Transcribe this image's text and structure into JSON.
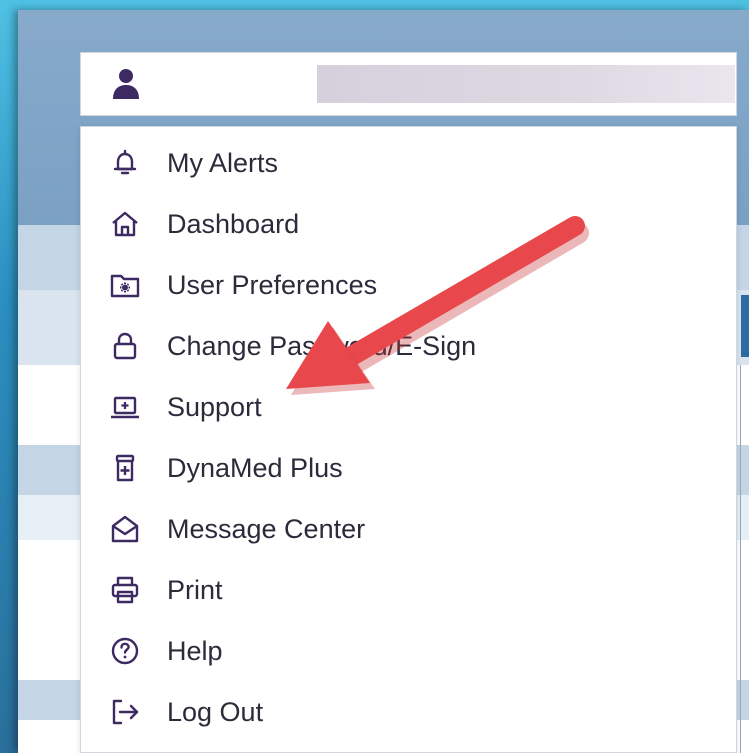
{
  "user_bar": {
    "user_icon": "user-icon",
    "username_redacted": true
  },
  "menu": {
    "items": [
      {
        "label": "My Alerts",
        "icon": "bell-icon"
      },
      {
        "label": "Dashboard",
        "icon": "home-icon"
      },
      {
        "label": "User Preferences",
        "icon": "folder-gear-icon"
      },
      {
        "label": "Change Password/E-Sign",
        "icon": "lock-icon"
      },
      {
        "label": "Support",
        "icon": "laptop-icon"
      },
      {
        "label": "DynaMed Plus",
        "icon": "medical-jar-icon"
      },
      {
        "label": "Message Center",
        "icon": "envelope-open-icon"
      },
      {
        "label": "Print",
        "icon": "printer-icon"
      },
      {
        "label": "Help",
        "icon": "help-circle-icon"
      },
      {
        "label": "Log Out",
        "icon": "logout-icon"
      }
    ]
  },
  "colors": {
    "icon": "#3d2a63",
    "text": "#2b2b3b",
    "arrow": "#e8484b",
    "header": "#87aacb",
    "outer_frame": "#2b8fc0"
  }
}
